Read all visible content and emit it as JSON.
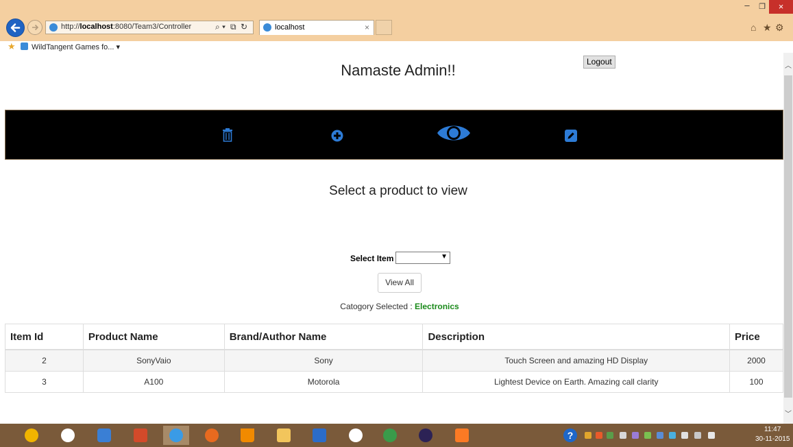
{
  "browser": {
    "address": "http://localhost:8080/Team3/Controller",
    "address_prefix": "http://",
    "address_host": "localhost",
    "address_path": ":8080/Team3/Controller",
    "tab_title": "localhost",
    "favorites_item": "WildTangent Games fo... ▾",
    "search_glyph": "⌕ ▾",
    "compat_glyph": "⧉",
    "refresh_glyph": "↻"
  },
  "page": {
    "greeting": "Namaste Admin!!",
    "logout_label": "Logout",
    "section_title": "Select a product to view",
    "select_label": "Select Item",
    "select_value": "",
    "view_all_label": "View All",
    "category_prefix": "Catogory Selected : ",
    "category_value": "Electronics"
  },
  "nav_icons": [
    "trash-icon",
    "add-icon",
    "eye-icon",
    "edit-icon"
  ],
  "accent_colors": {
    "navbar": "#000000",
    "nav_icon": "#2d7bd6",
    "category": "#1a8a1a"
  },
  "table": {
    "headers": [
      "Item Id",
      "Product Name",
      "Brand/Author Name",
      "Description",
      "Price"
    ],
    "rows": [
      [
        "2",
        "SonyVaio",
        "Sony",
        "Touch Screen and amazing HD Display",
        "2000"
      ],
      [
        "3",
        "A100",
        "Motorola",
        "Lightest Device on Earth. Amazing call clarity",
        "100"
      ]
    ]
  },
  "taskbar": {
    "time": "11:47",
    "date": "30-11-2015"
  }
}
